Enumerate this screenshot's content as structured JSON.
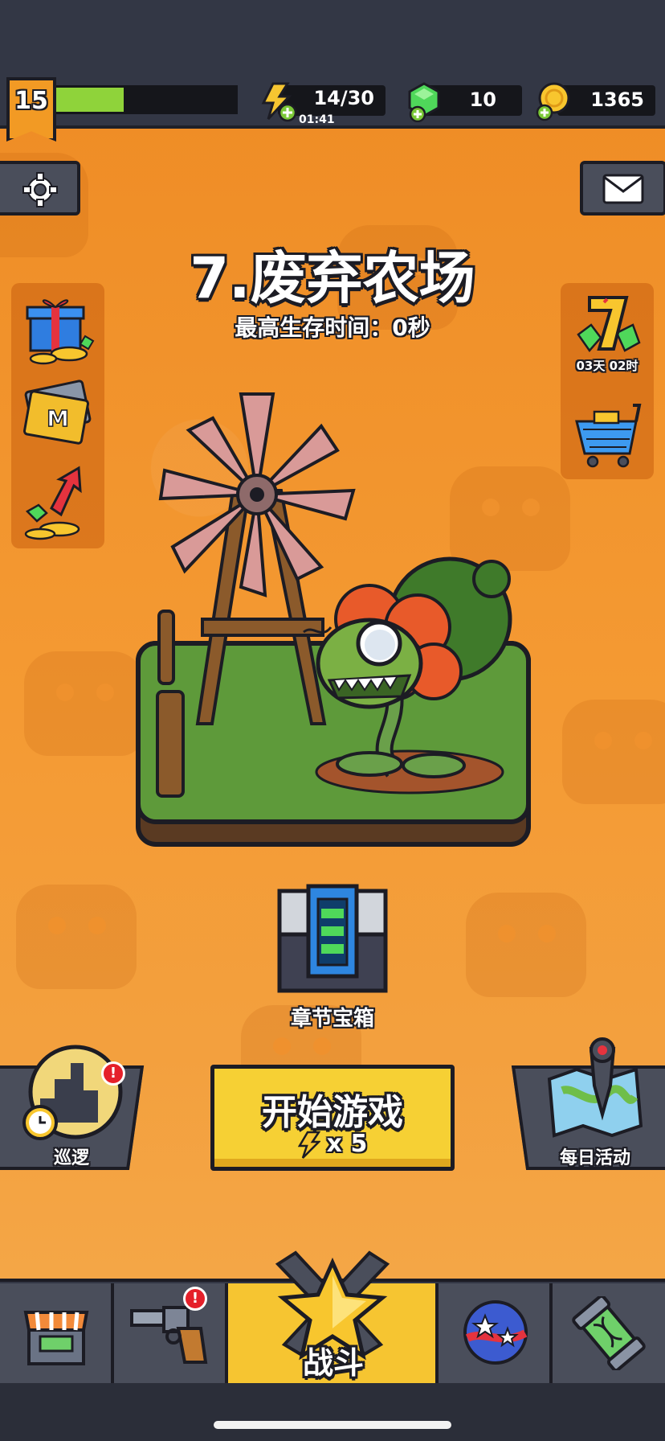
{
  "hud": {
    "level": "15",
    "xp_progress": 0.38,
    "energy": "14/30",
    "energy_timer": "01:41",
    "gems": "10",
    "coins": "1365"
  },
  "stage": {
    "title": "7.废弃农场",
    "subtitle": "最高生存时间：0秒"
  },
  "event_timer": "03天 02时",
  "chapter_chest_label": "章节宝箱",
  "actions": {
    "patrol_label": "巡逻",
    "patrol_badge": "!",
    "start_label": "开始游戏",
    "start_cost": "x 5",
    "daily_label": "每日活动"
  },
  "nav": {
    "battle_label": "战斗",
    "weapons_badge": "!"
  },
  "colors": {
    "background": "#f0902a",
    "hud": "#333745",
    "accent_yellow": "#f6d034",
    "xp_green": "#8fd33a"
  }
}
